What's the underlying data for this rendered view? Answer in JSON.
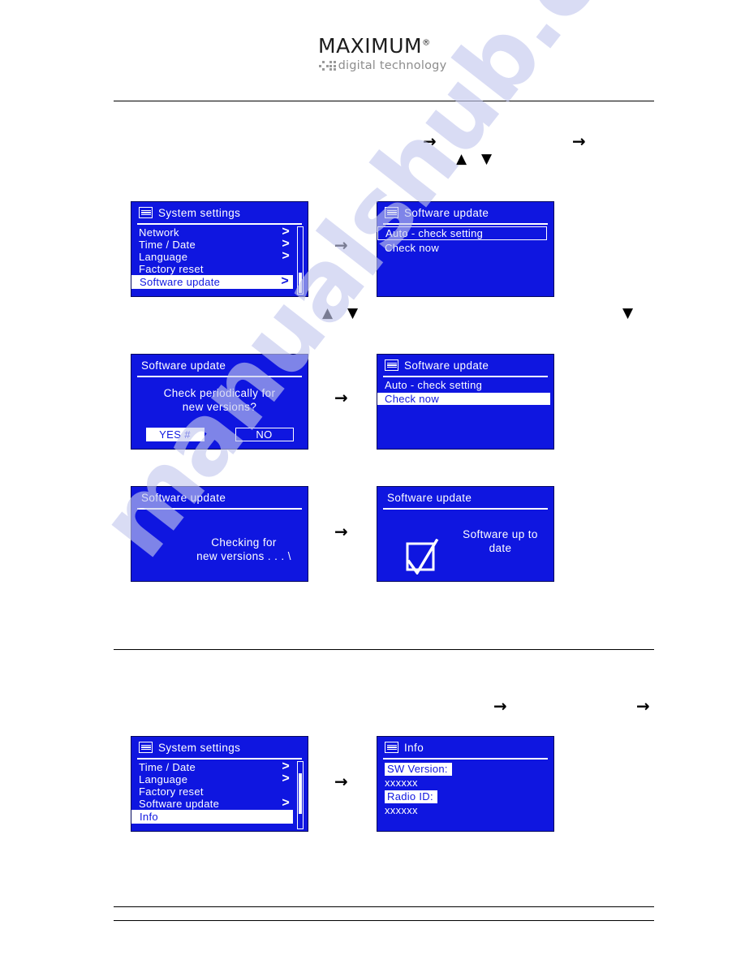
{
  "brand": {
    "name": "MAXIMUM",
    "registered": "®",
    "tagline": "digital technology"
  },
  "watermark": {
    "text": "manualshub.com"
  },
  "icons": {
    "menu": "menu-list-icon",
    "chevron": ">",
    "arrow_right": "→",
    "triangle_up": "▲",
    "triangle_down": "▼",
    "checkbox_check": "checkbox-check-icon"
  },
  "screens": {
    "system_settings_1": {
      "title": "System  settings",
      "items": [
        {
          "label": "Network",
          "chevron": ">",
          "state": "normal"
        },
        {
          "label": "Time / Date",
          "chevron": ">",
          "state": "normal"
        },
        {
          "label": "Language",
          "chevron": ">",
          "state": "normal"
        },
        {
          "label": "Factory  reset",
          "chevron": "",
          "state": "normal"
        },
        {
          "label": "Software  update",
          "chevron": ">",
          "state": "selected"
        }
      ]
    },
    "software_update_menu_1": {
      "title": "Software  update",
      "items": [
        {
          "label": "Auto - check  setting",
          "state": "outline"
        },
        {
          "label": "Check  now",
          "state": "normal"
        }
      ]
    },
    "confirm_dialog": {
      "title": "Software  update",
      "message_line1": "Check  periodically  for",
      "message_line2": "new  versions?",
      "yes_label": "YES #",
      "no_label": "NO"
    },
    "software_update_menu_2": {
      "title": "Software  update",
      "items": [
        {
          "label": "Auto - check  setting",
          "state": "normal"
        },
        {
          "label": "Check  now",
          "state": "white-fill"
        }
      ]
    },
    "checking": {
      "title": "Software  update",
      "message_line1": "Checking  for",
      "message_line2": "new  versions . . . \\"
    },
    "up_to_date": {
      "title": "Software  update",
      "message_line1": "Software  up  to",
      "message_line2": "date"
    },
    "system_settings_2": {
      "title": "System  settings",
      "items": [
        {
          "label": "Time / Date",
          "chevron": ">",
          "state": "normal"
        },
        {
          "label": "Language",
          "chevron": ">",
          "state": "normal"
        },
        {
          "label": "Factory  reset",
          "chevron": "",
          "state": "normal"
        },
        {
          "label": "Software  update",
          "chevron": ">",
          "state": "normal"
        },
        {
          "label": "Info",
          "chevron": "",
          "state": "selected"
        }
      ]
    },
    "info": {
      "title": "Info",
      "lines": [
        {
          "text": "SW  Version:",
          "highlight": true
        },
        {
          "text": "xxxxxx",
          "highlight": false
        },
        {
          "text": "Radio  ID:",
          "highlight": true
        },
        {
          "text": "xxxxxx",
          "highlight": false
        }
      ]
    }
  },
  "colors": {
    "lcd_background": "#0f16e0",
    "lcd_foreground": "#ffffff",
    "watermark": "#c3c8ee"
  }
}
